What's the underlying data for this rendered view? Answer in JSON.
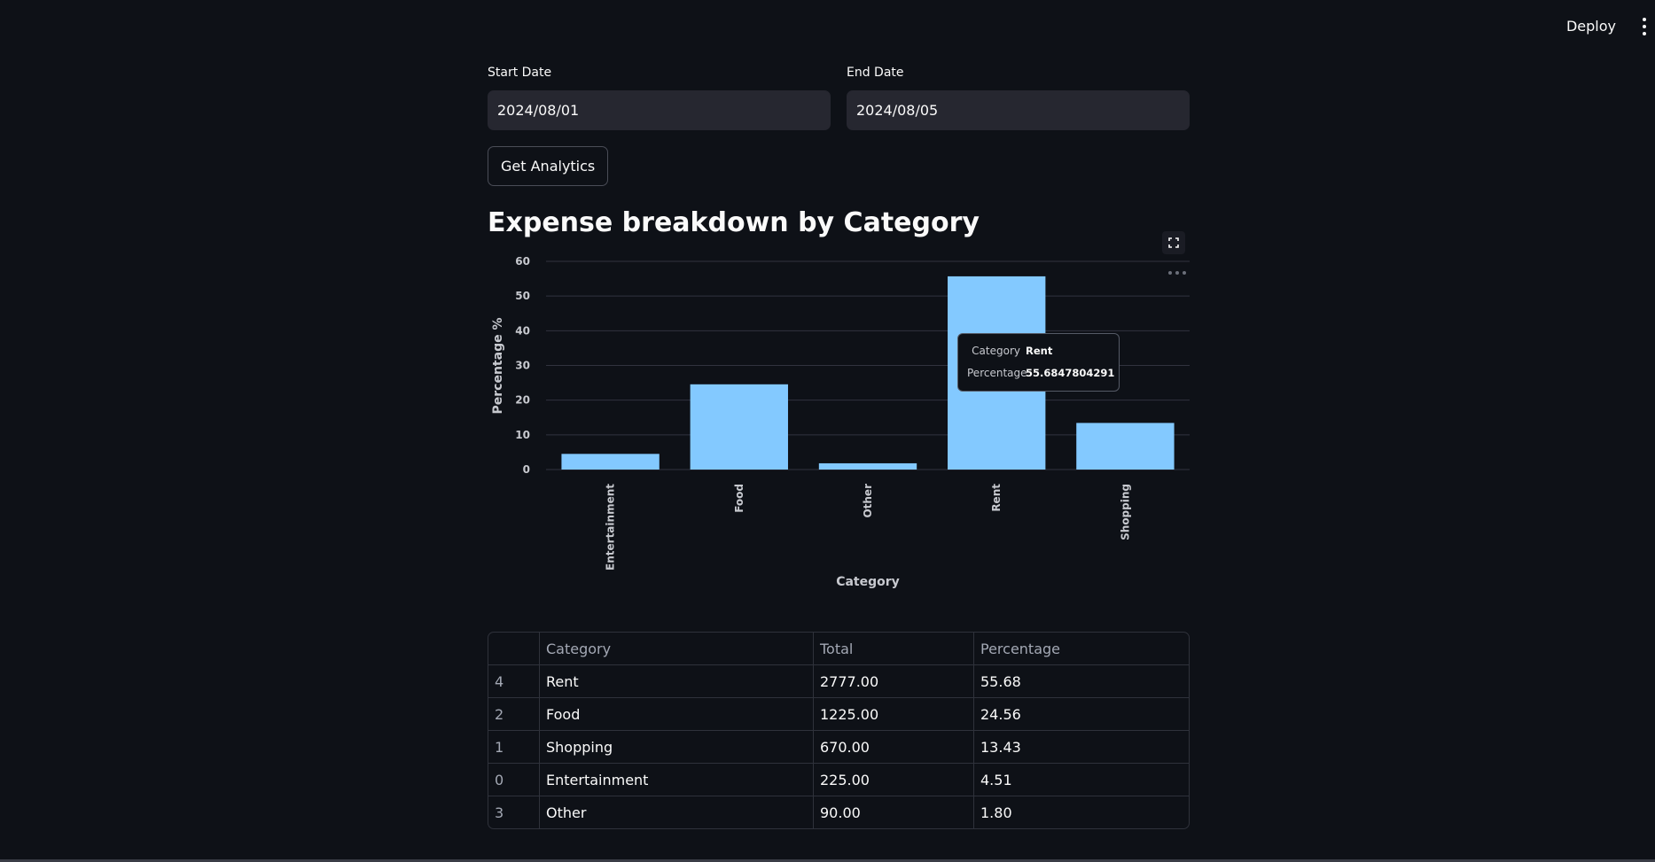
{
  "header": {
    "deploy_label": "Deploy",
    "menu_icon": "vertical-dots-icon"
  },
  "form": {
    "start_date": {
      "label": "Start Date",
      "value": "2024/08/01"
    },
    "end_date": {
      "label": "End Date",
      "value": "2024/08/05"
    },
    "submit_label": "Get Analytics"
  },
  "section": {
    "title": "Expense breakdown by Category"
  },
  "chart_data": {
    "type": "bar",
    "xlabel": "Category",
    "ylabel": "Percentage %",
    "categories": [
      "Entertainment",
      "Food",
      "Other",
      "Rent",
      "Shopping"
    ],
    "values": [
      4.51,
      24.56,
      1.8,
      55.68,
      13.43
    ],
    "yticks": [
      0,
      10,
      20,
      30,
      40,
      50,
      60
    ],
    "ylim": [
      0,
      60
    ],
    "grid": true,
    "bar_color": "#83c9ff",
    "tooltip": {
      "category_label": "Category",
      "category_value": "Rent",
      "percentage_label": "Percentage",
      "percentage_value": "55.6847804291"
    }
  },
  "table": {
    "columns": [
      "",
      "Category",
      "Total",
      "Percentage"
    ],
    "rows": [
      [
        "4",
        "Rent",
        "2777.00",
        "55.68"
      ],
      [
        "2",
        "Food",
        "1225.00",
        "24.56"
      ],
      [
        "1",
        "Shopping",
        "670.00",
        "13.43"
      ],
      [
        "0",
        "Entertainment",
        "225.00",
        "4.51"
      ],
      [
        "3",
        "Other",
        "90.00",
        "1.80"
      ]
    ]
  },
  "colors": {
    "background": "#0e1117",
    "input_background": "#262730",
    "text": "#fafafa",
    "bar": "#83c9ff"
  }
}
